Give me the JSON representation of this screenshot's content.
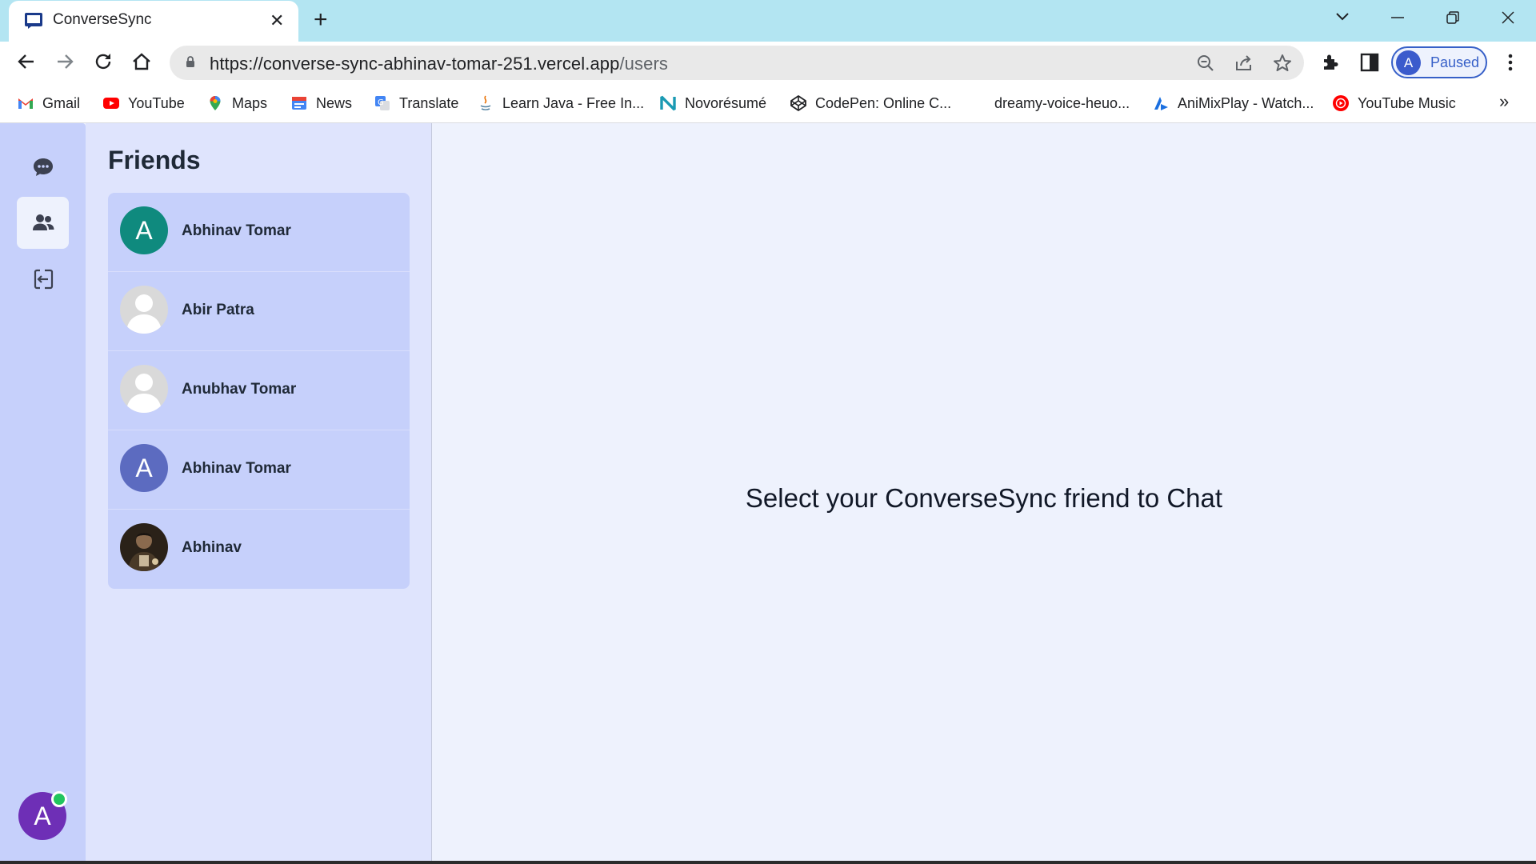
{
  "browser": {
    "tab": {
      "title": "ConverseSync",
      "favicon": "chat-favicon"
    },
    "controls": {
      "tab_search": "chevron-down-icon",
      "minimize": "minimize-icon",
      "restore": "restore-icon",
      "close": "close-icon"
    },
    "toolbar": {
      "url_base": "https://converse-sync-abhinav-tomar-251.vercel.app",
      "url_path": "/users",
      "profile_initial": "A",
      "profile_status": "Paused"
    },
    "bookmarks": [
      {
        "label": "Gmail",
        "icon": "gmail-icon"
      },
      {
        "label": "YouTube",
        "icon": "youtube-icon"
      },
      {
        "label": "Maps",
        "icon": "maps-icon"
      },
      {
        "label": "News",
        "icon": "news-icon"
      },
      {
        "label": "Translate",
        "icon": "translate-icon"
      },
      {
        "label": "Learn Java - Free In...",
        "icon": "java-icon"
      },
      {
        "label": "Novorésumé",
        "icon": "novoresume-icon"
      },
      {
        "label": "CodePen: Online C...",
        "icon": "codepen-icon"
      },
      {
        "label": "dreamy-voice-heuo...",
        "icon": ""
      },
      {
        "label": "AniMixPlay - Watch...",
        "icon": "animixplay-icon"
      },
      {
        "label": "YouTube Music",
        "icon": "youtube-music-icon"
      }
    ],
    "bookmarks_overflow": "»"
  },
  "app": {
    "rail": {
      "items": [
        {
          "name": "chats",
          "icon": "chat-bubble-icon"
        },
        {
          "name": "users",
          "icon": "users-icon",
          "active": true
        },
        {
          "name": "logout",
          "icon": "logout-icon"
        }
      ],
      "avatar_initial": "A",
      "online": true
    },
    "friends": {
      "title": "Friends",
      "list": [
        {
          "name": "Abhinav Tomar",
          "avatar_type": "letter",
          "initial": "A",
          "color": "#0f8a7e"
        },
        {
          "name": "Abir Patra",
          "avatar_type": "placeholder"
        },
        {
          "name": "Anubhav Tomar",
          "avatar_type": "placeholder"
        },
        {
          "name": "Abhinav Tomar",
          "avatar_type": "letter",
          "initial": "A",
          "color": "#5c6bc0"
        },
        {
          "name": "Abhinav",
          "avatar_type": "photo"
        }
      ]
    },
    "main": {
      "empty_message": "Select your ConverseSync friend to Chat"
    }
  }
}
